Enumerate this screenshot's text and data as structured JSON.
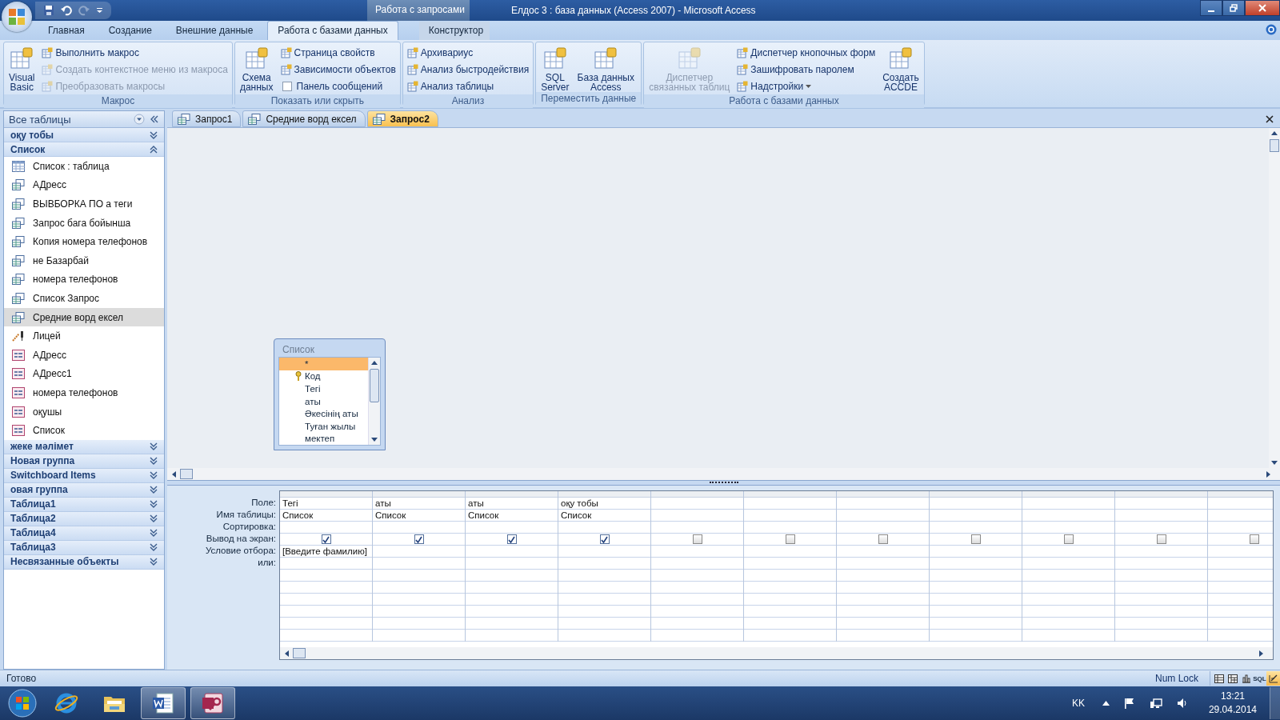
{
  "window": {
    "context_tab_group": "Работа с запросами",
    "title": "Елдос 3 : база данных (Access 2007) - Microsoft Access"
  },
  "ribbon_tabs": [
    {
      "label": "Главная",
      "selected": false
    },
    {
      "label": "Создание",
      "selected": false
    },
    {
      "label": "Внешние данные",
      "selected": false
    },
    {
      "label": "Работа с базами данных",
      "selected": true
    },
    {
      "label": "Конструктор",
      "selected": false
    }
  ],
  "ribbon_groups": [
    {
      "label": "Макрос",
      "buttons": [
        {
          "kind": "large",
          "label": "Visual\nBasic",
          "disabled": false
        },
        {
          "kind": "small",
          "label": "Выполнить макрос",
          "disabled": false
        },
        {
          "kind": "small",
          "label": "Создать контекстное меню из макроса",
          "disabled": true
        },
        {
          "kind": "small",
          "label": "Преобразовать макросы",
          "disabled": true
        }
      ]
    },
    {
      "label": "Показать или скрыть",
      "buttons": [
        {
          "kind": "large",
          "label": "Схема\nданных",
          "disabled": false
        },
        {
          "kind": "small",
          "label": "Страница свойств",
          "disabled": false
        },
        {
          "kind": "small",
          "label": "Зависимости объектов",
          "disabled": false
        },
        {
          "kind": "checkbox",
          "label": "Панель сообщений",
          "checked": false,
          "disabled": false
        }
      ]
    },
    {
      "label": "Анализ",
      "buttons": [
        {
          "kind": "small",
          "label": "Архивариус",
          "disabled": false
        },
        {
          "kind": "small",
          "label": "Анализ быстродействия",
          "disabled": false
        },
        {
          "kind": "small",
          "label": "Анализ таблицы",
          "disabled": false
        }
      ]
    },
    {
      "label": "Переместить данные",
      "buttons": [
        {
          "kind": "large",
          "label": "SQL\nServer",
          "disabled": false
        },
        {
          "kind": "large",
          "label": "База данных\nAccess",
          "disabled": false
        }
      ]
    },
    {
      "label": "Работа с базами данных",
      "buttons": [
        {
          "kind": "large",
          "label": "Диспетчер\nсвязанных таблиц",
          "disabled": true
        },
        {
          "kind": "small",
          "label": "Диспетчер кнопочных форм",
          "disabled": false
        },
        {
          "kind": "small",
          "label": "Зашифровать паролем",
          "disabled": false
        },
        {
          "kind": "dropdown",
          "label": "Надстройки",
          "disabled": false
        },
        {
          "kind": "large",
          "label": "Создать\nACCDE",
          "disabled": false
        }
      ]
    }
  ],
  "navigation_pane": {
    "title": "Все таблицы",
    "groups": [
      {
        "label": "оқу тобы",
        "expanded": false
      },
      {
        "label": "Список",
        "expanded": true,
        "items": [
          {
            "kind": "table",
            "label": "Список : таблица",
            "selected": false
          },
          {
            "kind": "query",
            "label": "АДресс",
            "selected": false
          },
          {
            "kind": "query",
            "label": "ВЫВБОРКА  ПО а теги",
            "selected": false
          },
          {
            "kind": "query",
            "label": "Запрос бага бойынша",
            "selected": false
          },
          {
            "kind": "query",
            "label": "Копия номера телефонов",
            "selected": false
          },
          {
            "kind": "query",
            "label": "не Базарбай",
            "selected": false
          },
          {
            "kind": "query",
            "label": "номера телефонов",
            "selected": false
          },
          {
            "kind": "query",
            "label": "Список Запрос",
            "selected": false
          },
          {
            "kind": "query",
            "label": "Средние ворд ексел",
            "selected": true
          },
          {
            "kind": "macro",
            "label": "Лицей",
            "selected": false
          },
          {
            "kind": "form",
            "label": "АДресс",
            "selected": false
          },
          {
            "kind": "form",
            "label": "АДресс1",
            "selected": false
          },
          {
            "kind": "form",
            "label": "номера телефонов",
            "selected": false
          },
          {
            "kind": "form",
            "label": "оқушы",
            "selected": false
          },
          {
            "kind": "form",
            "label": "Список",
            "selected": false
          }
        ]
      },
      {
        "label": "жеке мәлімет",
        "expanded": false
      },
      {
        "label": "Новая группа",
        "expanded": false
      },
      {
        "label": "Switchboard Items",
        "expanded": false
      },
      {
        "label": "овая группа",
        "expanded": false
      },
      {
        "label": "Таблица1",
        "expanded": false
      },
      {
        "label": "Таблица2",
        "expanded": false
      },
      {
        "label": "Таблица4",
        "expanded": false
      },
      {
        "label": "Таблица3",
        "expanded": false
      },
      {
        "label": "Несвязанные объекты",
        "expanded": false
      }
    ]
  },
  "document_tabs": [
    {
      "label": "Запрос1",
      "selected": false
    },
    {
      "label": "Средние ворд ексел",
      "selected": false
    },
    {
      "label": "Запрос2",
      "selected": true
    }
  ],
  "field_list": {
    "title": "Список",
    "fields": [
      {
        "kind": "all",
        "label": "*",
        "selected": true
      },
      {
        "kind": "key",
        "label": "Код",
        "selected": false
      },
      {
        "kind": "field",
        "label": "Тегі",
        "selected": false
      },
      {
        "kind": "field",
        "label": "аты",
        "selected": false
      },
      {
        "kind": "field",
        "label": "Әкесінің аты",
        "selected": false
      },
      {
        "kind": "field",
        "label": "Туған жылы",
        "selected": false
      },
      {
        "kind": "field",
        "label": "мектеп",
        "selected": false
      }
    ]
  },
  "query_grid": {
    "row_labels": [
      "Поле:",
      "Имя таблицы:",
      "Сортировка:",
      "Вывод на экран:",
      "Условие отбора:",
      "или:"
    ],
    "columns": [
      {
        "field": "Тегі",
        "table": "Список",
        "show": true,
        "criteria": "[Введите фамилию]"
      },
      {
        "field": "аты",
        "table": "Список",
        "show": true
      },
      {
        "field": "аты",
        "table": "Список",
        "show": true
      },
      {
        "field": "оқу тобы",
        "table": "Список",
        "show": true
      },
      {
        "show": false
      },
      {
        "show": false
      },
      {
        "show": false
      },
      {
        "show": false
      },
      {
        "show": false
      },
      {
        "show": false
      },
      {
        "show": false
      }
    ]
  },
  "status_bar": {
    "text": "Готово",
    "num_lock": "Num Lock",
    "views": [
      {
        "kind": "datasheet",
        "selected": false
      },
      {
        "kind": "pivottable",
        "selected": false
      },
      {
        "kind": "pivotchart",
        "selected": false
      },
      {
        "kind": "sql",
        "label": "SQL",
        "selected": false
      },
      {
        "kind": "design",
        "selected": true
      }
    ]
  },
  "taskbar": {
    "apps": [
      {
        "kind": "browser",
        "active": false
      },
      {
        "kind": "folder",
        "active": false
      },
      {
        "kind": "word",
        "active": true
      },
      {
        "kind": "access",
        "active": true
      }
    ],
    "language": "KK",
    "time": "13:21",
    "date": "29.04.2014"
  }
}
